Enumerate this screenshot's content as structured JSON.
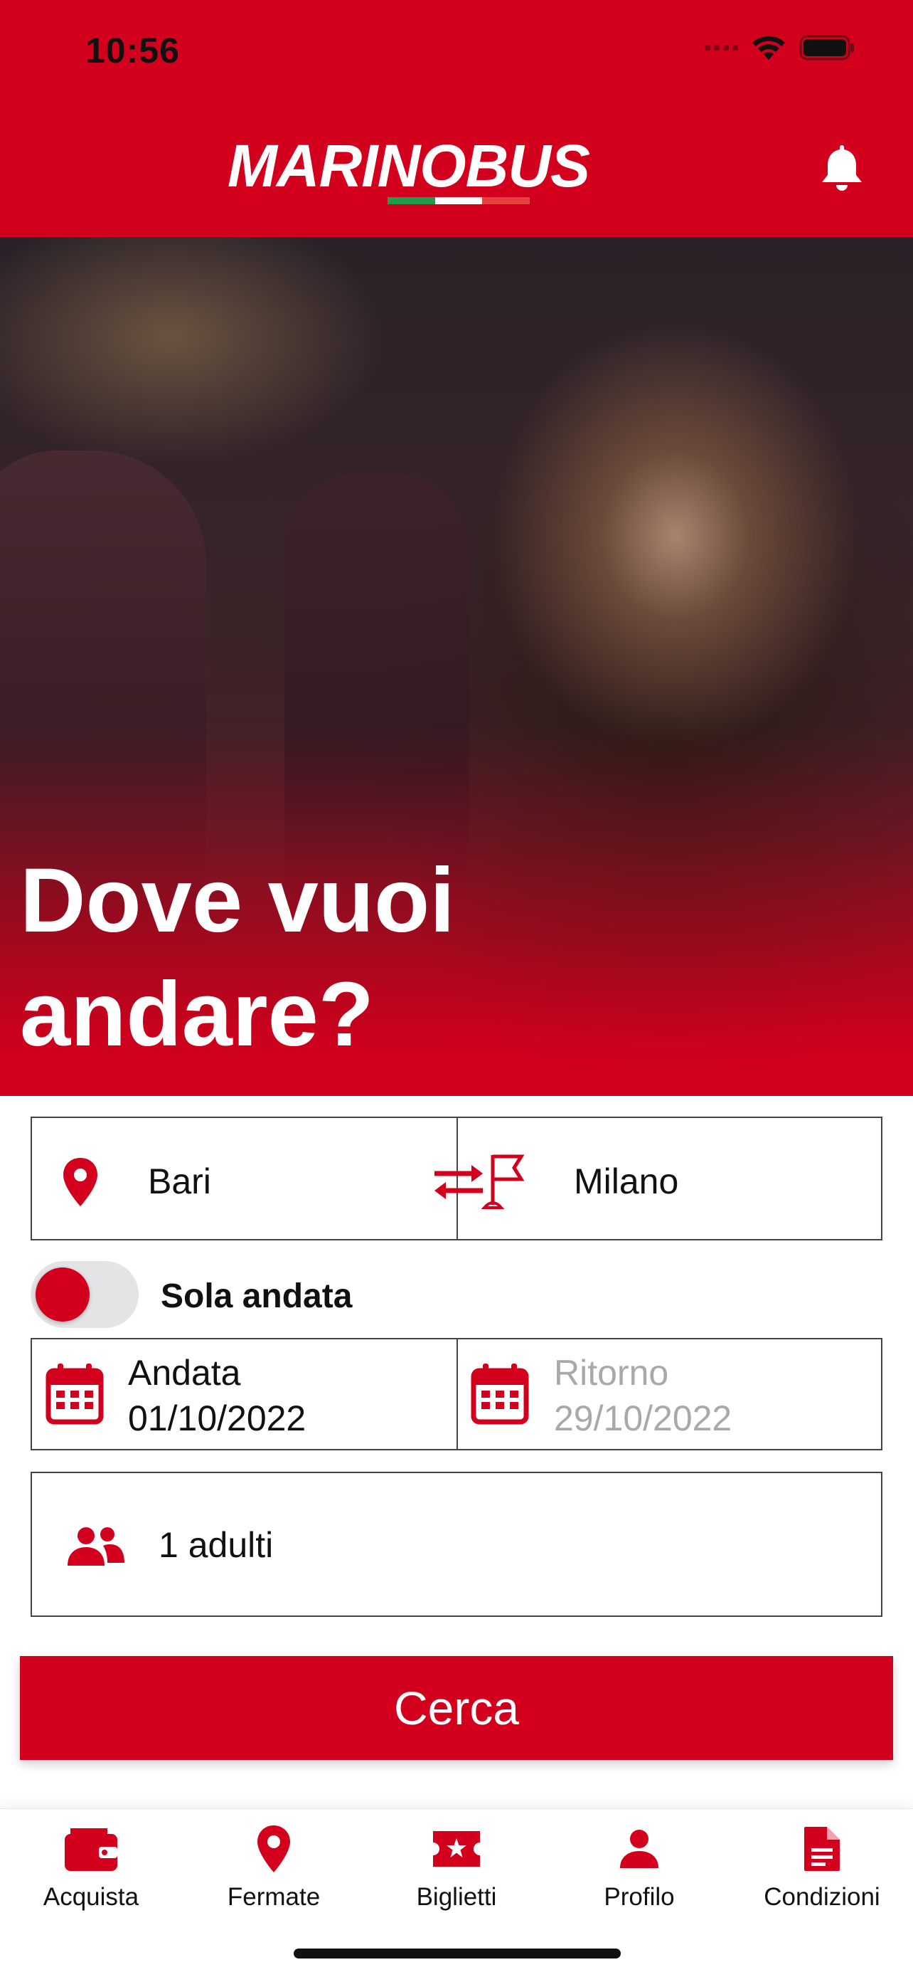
{
  "status_bar": {
    "time": "10:56"
  },
  "header": {
    "logo_part1": "MARINO",
    "logo_part2": "BUS",
    "logo_flag_colors": [
      "#1e9e4a",
      "#ffffff",
      "#e3423f"
    ],
    "bell_icon": "bell-icon"
  },
  "hero": {
    "title_line1": "Dove vuoi",
    "title_line2": "andare?"
  },
  "search": {
    "from": "Bari",
    "to": "Milano",
    "one_way_label": "Sola andata",
    "one_way_enabled": true,
    "outbound_label": "Andata",
    "outbound_date": "01/10/2022",
    "return_label": "Ritorno",
    "return_date": "29/10/2022",
    "passengers": "1 adulti",
    "search_button": "Cerca"
  },
  "tabbar": {
    "items": [
      {
        "label": "Acquista",
        "icon": "wallet-icon"
      },
      {
        "label": "Fermate",
        "icon": "map-pin-icon"
      },
      {
        "label": "Biglietti",
        "icon": "ticket-star-icon"
      },
      {
        "label": "Profilo",
        "icon": "person-icon"
      },
      {
        "label": "Condizioni",
        "icon": "document-icon"
      }
    ]
  },
  "colors": {
    "brand_red": "#d3001d",
    "placeholder_gray": "#a9a9ad"
  }
}
